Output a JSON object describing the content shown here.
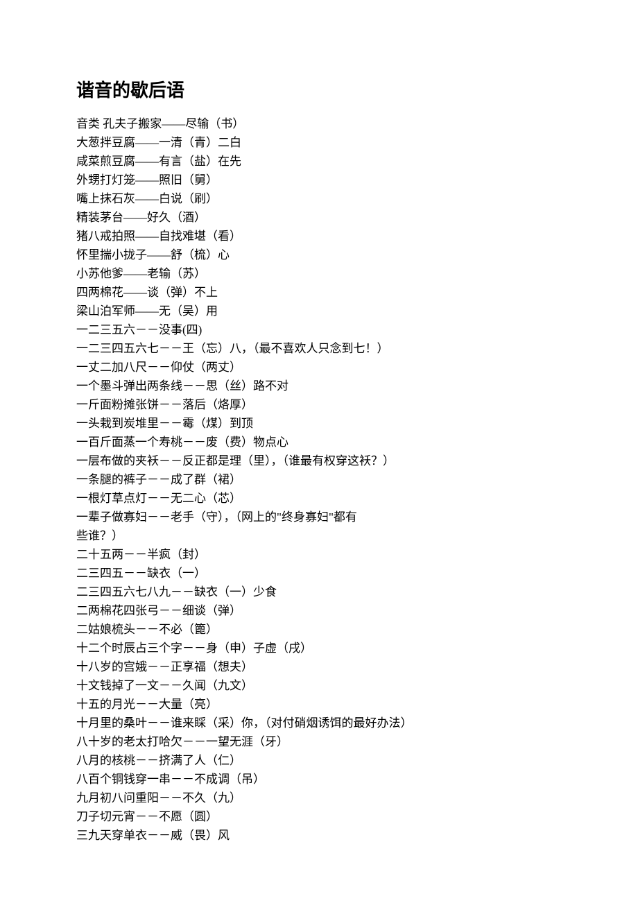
{
  "title": "谐音的歇后语",
  "lines": [
    "音类 孔夫子搬家——尽输（书）",
    "大葱拌豆腐——一清（青）二白",
    "咸菜煎豆腐——有言（盐）在先",
    "外甥打灯笼——照旧（舅）",
    "嘴上抹石灰——白说（刷）",
    "精装茅台——好久（酒）",
    "猪八戒拍照——自找难堪（看）",
    "怀里揣小拢子——舒（梳）心",
    "小苏他爹——老输（苏）",
    "四两棉花——谈（弹）不上",
    "梁山泊军师——无（吴）用",
    "一二三五六－－没事(四)",
    "一二三四五六七－－王（忘）八，（最不喜欢人只念到七！）",
    "一丈二加八尺－－仰仗（两丈）",
    "一个墨斗弹出两条线－－思（丝）路不对",
    "一斤面粉摊张饼－－落后（烙厚）",
    "一头栽到炭堆里－－霉（煤）到顶",
    "一百斤面蒸一个寿桃－－废（费）物点心",
    "一层布做的夹袄－－反正都是理（里），（谁最有权穿这袄？）",
    "一条腿的裤子－－成了群（裙）",
    "一根灯草点灯－－无二心（芯）",
    "一辈子做寡妇－－老手（守），（网上的\"终身寡妇\"都有",
    "些谁？）",
    "二十五两－－半疯（封）",
    "二三四五－－缺衣（一）",
    "二三四五六七八九－－缺衣（一）少食",
    "二两棉花四张弓－－细谈（弹）",
    "二姑娘梳头－－不必（篦）",
    "十二个时辰占三个字－－身（申）子虚（戌）",
    "十八岁的宫娥－－正享福（想夫）",
    "十文钱掉了一文－－久闻（九文）",
    "十五的月光－－大量（亮）",
    "十月里的桑叶－－谁来睬（采）你，（对付硝烟诱饵的最好办法）",
    "八十岁的老太打哈欠－－一望无涯（牙）",
    "八月的核桃－－挤满了人（仁）",
    "八百个铜钱穿一串－－不成调（吊）",
    "九月初八问重阳－－不久（九）",
    "刀子切元宵－－不愿（圆）",
    "三九天穿单衣－－威（畏）风"
  ]
}
